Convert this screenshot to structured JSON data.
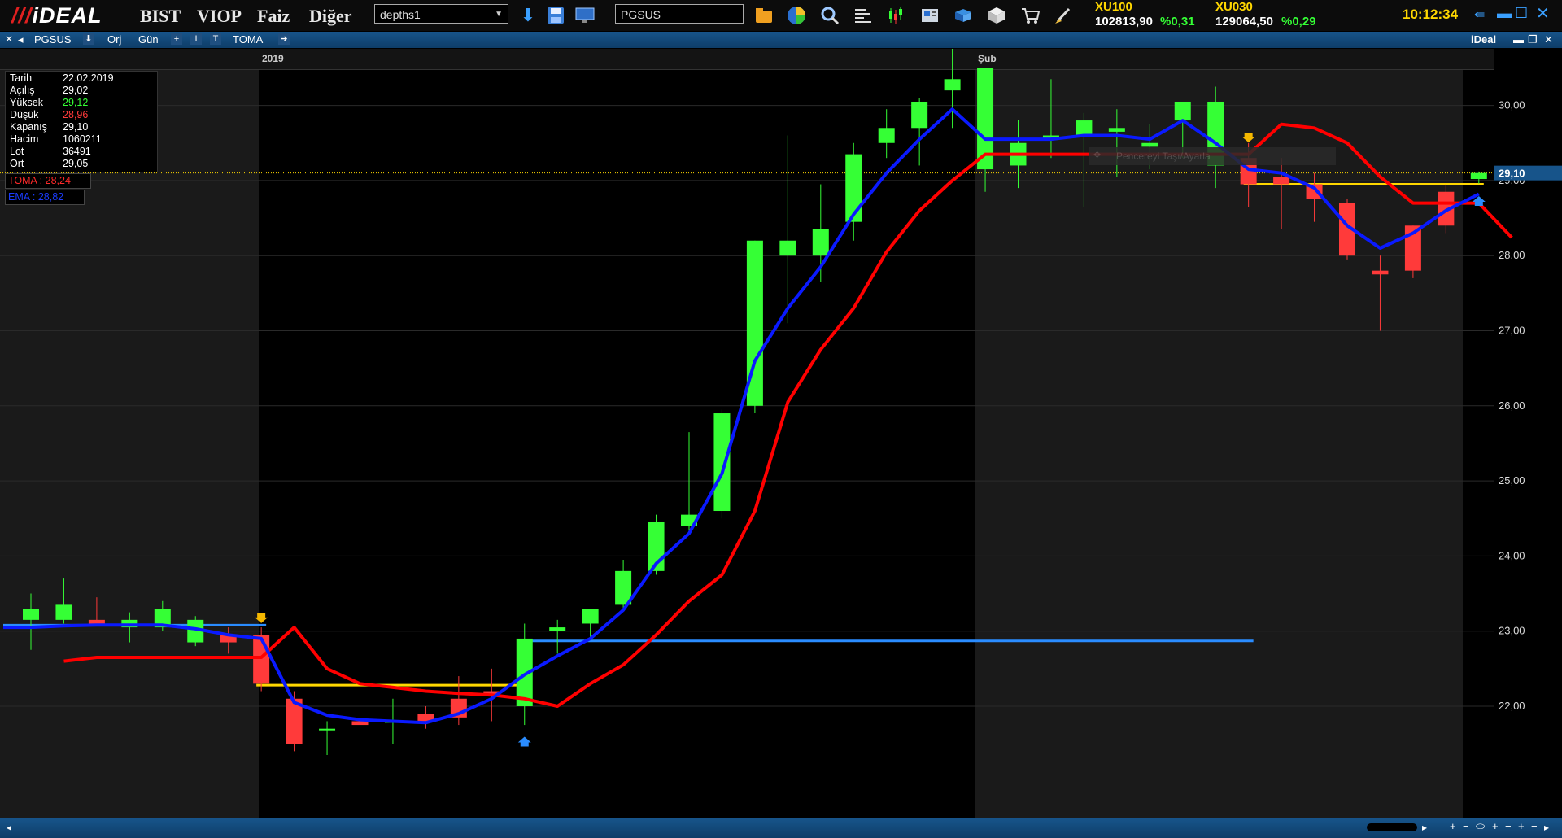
{
  "app": {
    "logo": "iDEAL",
    "menu": [
      "BIST",
      "VIOP",
      "Faiz",
      "Diğer"
    ],
    "depth_select": "depths1",
    "symbol_input": "PGSUS",
    "indices": [
      {
        "name": "XU100",
        "value": "102813,90",
        "change": "%0,31"
      },
      {
        "name": "XU030",
        "value": "129064,50",
        "change": "%0,29"
      }
    ],
    "clock": "10:12:34",
    "window_brand": "iDeal",
    "colors": {
      "up": "#35ff35",
      "down": "#ff3a3a",
      "ema": "#0a1aff",
      "toma": "#ff0000",
      "level": "#ffd700",
      "support": "#2a8cff"
    }
  },
  "toolbar": {
    "symbol": "PGSUS",
    "orj": "Orj",
    "period": "Gün",
    "indicator": "TOMA"
  },
  "info_box": {
    "rows": [
      {
        "label": "Tarih",
        "value": "22.02.2019"
      },
      {
        "label": "Açılış",
        "value": "29,02",
        "color": "#ffffff"
      },
      {
        "label": "Yüksek",
        "value": "29,12",
        "color": "#35ff35"
      },
      {
        "label": "Düşük",
        "value": "28,96",
        "color": "#ff3a3a"
      },
      {
        "label": "Kapanış",
        "value": "29,10",
        "color": "#ffffff"
      },
      {
        "label": "Hacim",
        "value": "1060211",
        "color": "#ffffff"
      },
      {
        "label": "Lot",
        "value": "36491",
        "color": "#ffffff"
      },
      {
        "label": "Ort",
        "value": "29,05",
        "color": "#ffffff"
      }
    ],
    "toma_label": "TOMA : 28,24",
    "ema_label": "EMA : 28,82"
  },
  "chart_data": {
    "type": "candlestick",
    "symbol": "PGSUS",
    "period_labels": [
      "2019",
      "Şub"
    ],
    "ylim": [
      21.0,
      31.0
    ],
    "yticks": [
      "22,00",
      "23,00",
      "24,00",
      "25,00",
      "26,00",
      "27,00",
      "28,00",
      "29,00",
      "30,00"
    ],
    "ytick_values": [
      22,
      23,
      24,
      25,
      26,
      27,
      28,
      29,
      30
    ],
    "last_price": "29,10",
    "last_value": 29.1,
    "candles": [
      {
        "o": 23.15,
        "h": 23.5,
        "l": 22.75,
        "c": 23.3
      },
      {
        "o": 23.15,
        "h": 23.7,
        "l": 23.1,
        "c": 23.35
      },
      {
        "o": 23.15,
        "h": 23.45,
        "l": 23.1,
        "c": 23.1
      },
      {
        "o": 23.05,
        "h": 23.25,
        "l": 22.85,
        "c": 23.15
      },
      {
        "o": 23.05,
        "h": 23.4,
        "l": 23.0,
        "c": 23.3
      },
      {
        "o": 22.85,
        "h": 23.2,
        "l": 22.8,
        "c": 23.15
      },
      {
        "o": 22.95,
        "h": 23.05,
        "l": 22.7,
        "c": 22.85
      },
      {
        "o": 22.95,
        "h": 23.05,
        "l": 22.2,
        "c": 22.3
      },
      {
        "o": 22.1,
        "h": 22.2,
        "l": 21.4,
        "c": 21.5
      },
      {
        "o": 21.7,
        "h": 21.8,
        "l": 21.35,
        "c": 21.7
      },
      {
        "o": 21.8,
        "h": 22.15,
        "l": 21.6,
        "c": 21.75
      },
      {
        "o": 21.8,
        "h": 22.1,
        "l": 21.5,
        "c": 21.8
      },
      {
        "o": 21.9,
        "h": 22.0,
        "l": 21.7,
        "c": 21.8
      },
      {
        "o": 22.1,
        "h": 22.4,
        "l": 21.75,
        "c": 21.85
      },
      {
        "o": 22.2,
        "h": 22.5,
        "l": 21.8,
        "c": 22.15
      },
      {
        "o": 22.0,
        "h": 23.1,
        "l": 21.75,
        "c": 22.9
      },
      {
        "o": 23.0,
        "h": 23.15,
        "l": 22.7,
        "c": 23.05
      },
      {
        "o": 23.1,
        "h": 23.3,
        "l": 22.9,
        "c": 23.3
      },
      {
        "o": 23.35,
        "h": 23.95,
        "l": 23.3,
        "c": 23.8
      },
      {
        "o": 23.8,
        "h": 24.55,
        "l": 23.75,
        "c": 24.45
      },
      {
        "o": 24.4,
        "h": 25.65,
        "l": 24.3,
        "c": 24.55
      },
      {
        "o": 24.6,
        "h": 25.95,
        "l": 24.5,
        "c": 25.9
      },
      {
        "o": 26.0,
        "h": 28.2,
        "l": 25.9,
        "c": 28.2
      },
      {
        "o": 28.0,
        "h": 29.6,
        "l": 27.1,
        "c": 28.2
      },
      {
        "o": 28.0,
        "h": 28.95,
        "l": 27.65,
        "c": 28.35
      },
      {
        "o": 28.45,
        "h": 29.5,
        "l": 28.2,
        "c": 29.35
      },
      {
        "o": 29.5,
        "h": 29.95,
        "l": 29.3,
        "c": 29.7
      },
      {
        "o": 29.7,
        "h": 30.1,
        "l": 29.2,
        "c": 30.05
      },
      {
        "o": 30.2,
        "h": 30.95,
        "l": 29.7,
        "c": 30.35
      },
      {
        "o": 29.15,
        "h": 30.5,
        "l": 28.85,
        "c": 30.5
      },
      {
        "o": 29.2,
        "h": 29.8,
        "l": 28.9,
        "c": 29.5
      },
      {
        "o": 29.55,
        "h": 30.35,
        "l": 29.3,
        "c": 29.6
      },
      {
        "o": 29.6,
        "h": 29.9,
        "l": 28.65,
        "c": 29.8
      },
      {
        "o": 29.65,
        "h": 29.95,
        "l": 29.05,
        "c": 29.7
      },
      {
        "o": 29.45,
        "h": 29.75,
        "l": 29.15,
        "c": 29.5
      },
      {
        "o": 29.8,
        "h": 30.05,
        "l": 29.3,
        "c": 30.05
      },
      {
        "o": 29.2,
        "h": 30.25,
        "l": 28.9,
        "c": 30.05
      },
      {
        "o": 29.3,
        "h": 29.5,
        "l": 28.65,
        "c": 28.95
      },
      {
        "o": 29.05,
        "h": 29.3,
        "l": 28.35,
        "c": 28.95
      },
      {
        "o": 28.95,
        "h": 29.1,
        "l": 28.45,
        "c": 28.75
      },
      {
        "o": 28.7,
        "h": 28.75,
        "l": 27.95,
        "c": 28.0
      },
      {
        "o": 27.8,
        "h": 28.0,
        "l": 27.0,
        "c": 27.75
      },
      {
        "o": 28.4,
        "h": 28.4,
        "l": 27.7,
        "c": 27.8
      },
      {
        "o": 28.85,
        "h": 28.95,
        "l": 28.3,
        "c": 28.4
      },
      {
        "o": 29.02,
        "h": 29.12,
        "l": 28.96,
        "c": 29.1
      }
    ],
    "ema": [
      23.05,
      23.07,
      23.08,
      23.08,
      23.08,
      23.03,
      22.95,
      22.9,
      22.05,
      21.88,
      21.82,
      21.8,
      21.78,
      21.9,
      22.1,
      22.42,
      22.67,
      22.9,
      23.28,
      23.9,
      24.3,
      25.1,
      26.6,
      27.3,
      27.85,
      28.55,
      29.1,
      29.55,
      29.95,
      29.55,
      29.55,
      29.55,
      29.6,
      29.6,
      29.55,
      29.8,
      29.5,
      29.15,
      29.1,
      28.9,
      28.4,
      28.1,
      28.3,
      28.6,
      28.82
    ],
    "toma": [
      22.6,
      22.65,
      22.65,
      22.65,
      22.65,
      22.65,
      22.65,
      23.05,
      22.5,
      22.3,
      22.25,
      22.2,
      22.17,
      22.15,
      22.1,
      22.0,
      22.3,
      22.55,
      22.95,
      23.4,
      23.75,
      24.6,
      26.05,
      26.75,
      27.3,
      28.05,
      28.6,
      29.0,
      29.35,
      29.35,
      29.35,
      29.35,
      29.35,
      29.35,
      29.35,
      29.35,
      29.35,
      29.75,
      29.7,
      29.5,
      29.05,
      28.7,
      28.7,
      28.7,
      28.24
    ],
    "ema_start": 0,
    "toma_start": 1,
    "toma_end": 44,
    "horizontal_levels": [
      {
        "price": 23.08,
        "from": 0,
        "to": 7,
        "color": "#2a8cff"
      },
      {
        "price": 22.28,
        "from": 7,
        "to": 15,
        "color": "#ffd700"
      },
      {
        "price": 22.87,
        "from": 15,
        "to": 37,
        "color": "#2a8cff"
      },
      {
        "price": 28.95,
        "from": 37,
        "to": 44,
        "color": "#ffd700"
      }
    ],
    "signals": [
      {
        "index": 7,
        "dir": "down",
        "price": 23.15
      },
      {
        "index": 15,
        "dir": "up",
        "price": 21.55
      },
      {
        "index": 37,
        "dir": "down",
        "price": 29.55
      },
      {
        "index": 44,
        "dir": "up",
        "price": 28.75
      }
    ],
    "tooltip_text": "Pencereyi Taşı/Ayarla"
  }
}
